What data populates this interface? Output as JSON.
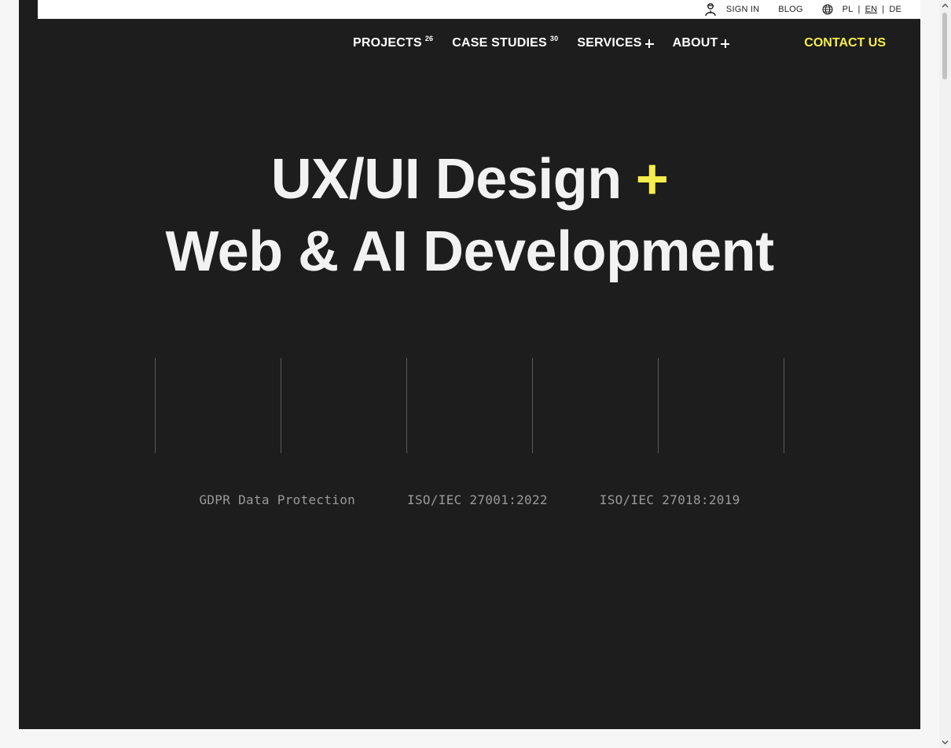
{
  "util": {
    "sign_in": "SIGN IN",
    "blog": "BLOG",
    "languages": [
      {
        "code": "PL",
        "active": false
      },
      {
        "code": "EN",
        "active": true
      },
      {
        "code": "DE",
        "active": false
      }
    ],
    "lang_separator": "|"
  },
  "nav": {
    "projects": {
      "label": "PROJECTS",
      "count": "26"
    },
    "case_studies": {
      "label": "CASE STUDIES",
      "count": "30"
    },
    "services": {
      "label": "SERVICES"
    },
    "about": {
      "label": "ABOUT"
    },
    "contact": "CONTACT US"
  },
  "hero": {
    "line1": "UX/UI Design",
    "plus": "+",
    "line2": "Web & AI Development"
  },
  "certifications": [
    "GDPR Data Protection",
    "ISO/IEC 27001:2022",
    "ISO/IEC 27018:2019"
  ],
  "colors": {
    "background": "#1d1d1d",
    "accent": "#f6ee4d",
    "text": "#f2f2f2"
  },
  "icons": {
    "user": "user-icon",
    "globe": "globe-icon",
    "plus": "plus-icon"
  }
}
